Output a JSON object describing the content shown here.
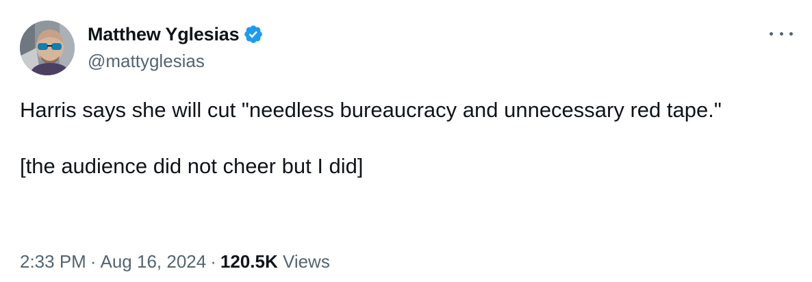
{
  "author": {
    "display_name": "Matthew Yglesias",
    "handle": "@mattyglesias",
    "verified_color": "#1d9bf0"
  },
  "tweet": {
    "paragraphs": [
      "Harris says she will cut \"needless bureaucracy and unnecessary red tape.\"",
      "[the audience did not cheer but I did]"
    ]
  },
  "meta": {
    "time": "2:33 PM",
    "date": "Aug 16, 2024",
    "separator": "·",
    "views_count": "120.5K",
    "views_label": "Views"
  },
  "icons": {
    "verified": "verified-badge-icon",
    "more": "more-horizontal-icon"
  }
}
